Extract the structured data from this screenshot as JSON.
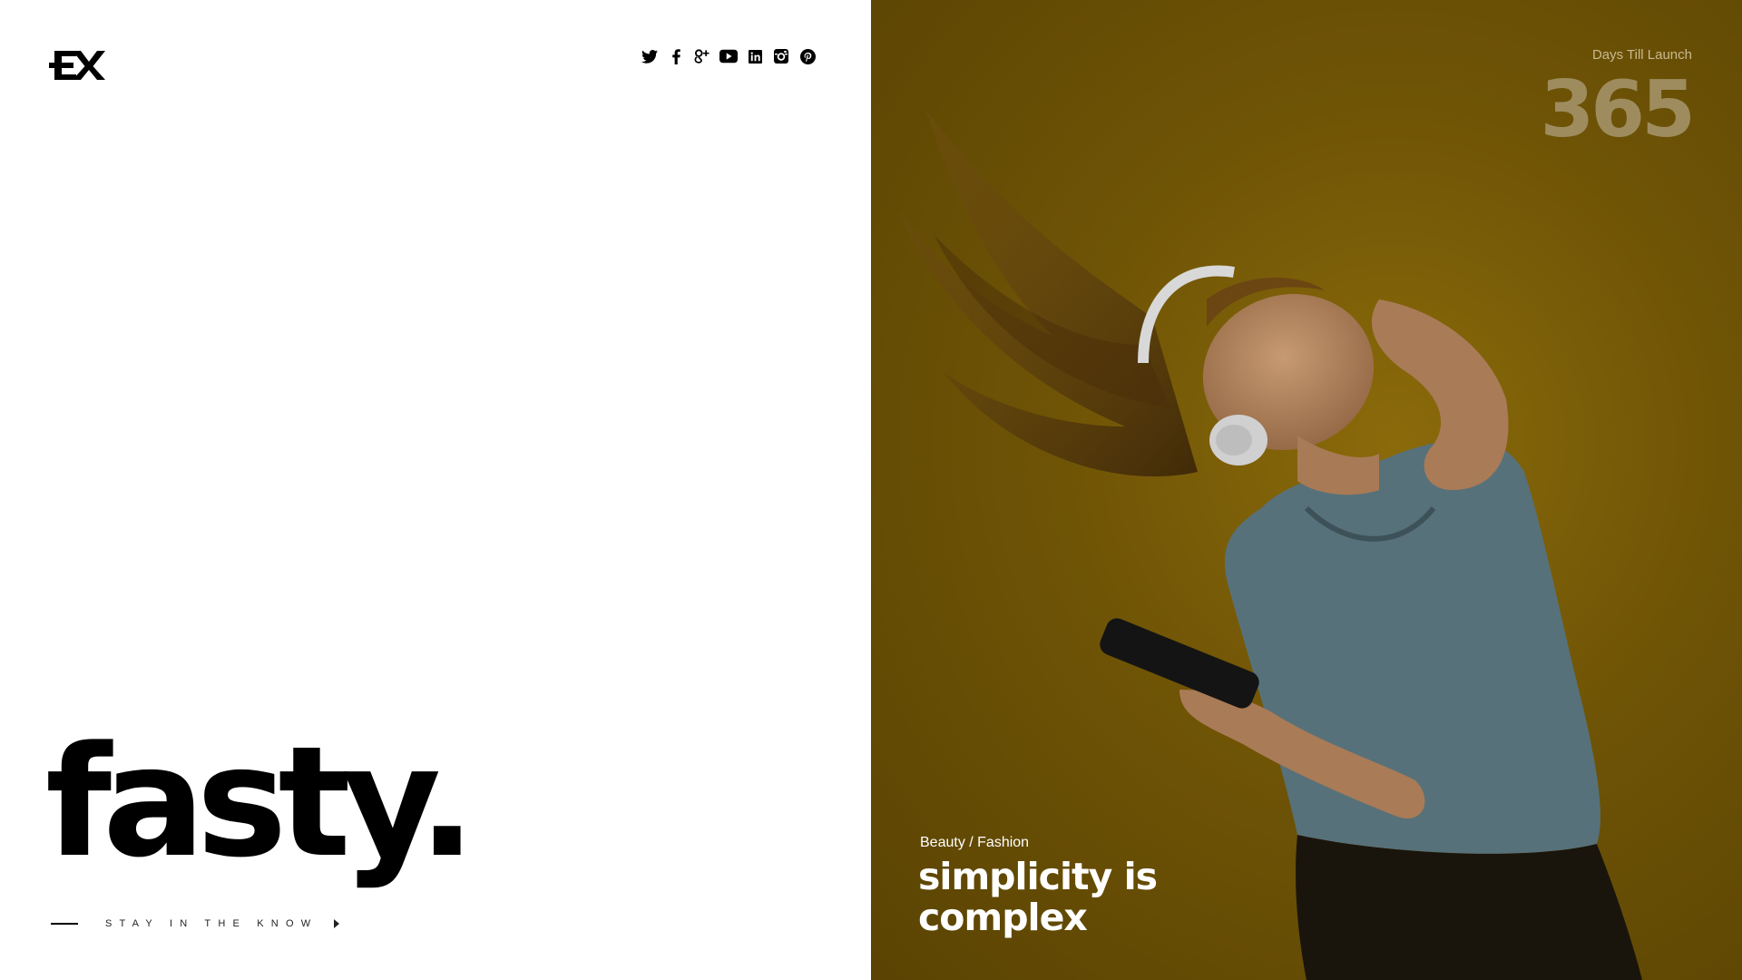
{
  "logo": {
    "text": "EX"
  },
  "social": {
    "icons": [
      "twitter-icon",
      "facebook-icon",
      "google-plus-icon",
      "youtube-icon",
      "linkedin-icon",
      "instagram-icon",
      "pinterest-icon"
    ]
  },
  "brand": {
    "title": "fasty."
  },
  "cta": {
    "label": "STAY IN THE KNOW"
  },
  "hero": {
    "countdown_label": "Days Till Launch",
    "countdown_value": "365",
    "category": "Beauty / Fashion",
    "headline_line1": "simplicity is",
    "headline_line2": "complex"
  },
  "colors": {
    "accent": "#6f5406",
    "text_dark": "#000000",
    "text_light": "#ffffff"
  }
}
